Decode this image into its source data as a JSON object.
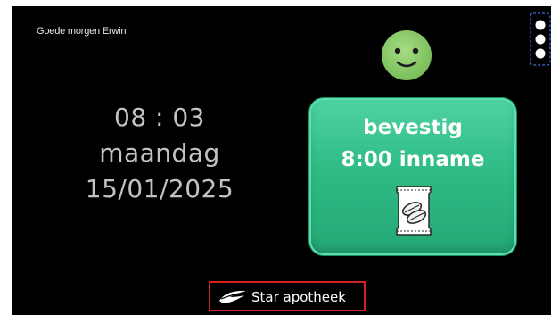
{
  "greeting": "Goede morgen  Erwin",
  "clock": {
    "time": "08 : 03",
    "day": "maandag",
    "date": "15/01/2025"
  },
  "confirm_button": {
    "line1": "bevestig",
    "line2": "8:00 inname",
    "icon": "pill-pack-icon"
  },
  "status_icon": "smiley-face-icon",
  "menu_icon": "more-dots-icon",
  "brand": {
    "name": "Star apotheek",
    "logo": "star-logo-icon"
  },
  "colors": {
    "background": "#000000",
    "button_green": "#2fbc85",
    "smiley_green": "#8ccc6a",
    "brand_border": "#d32020"
  }
}
